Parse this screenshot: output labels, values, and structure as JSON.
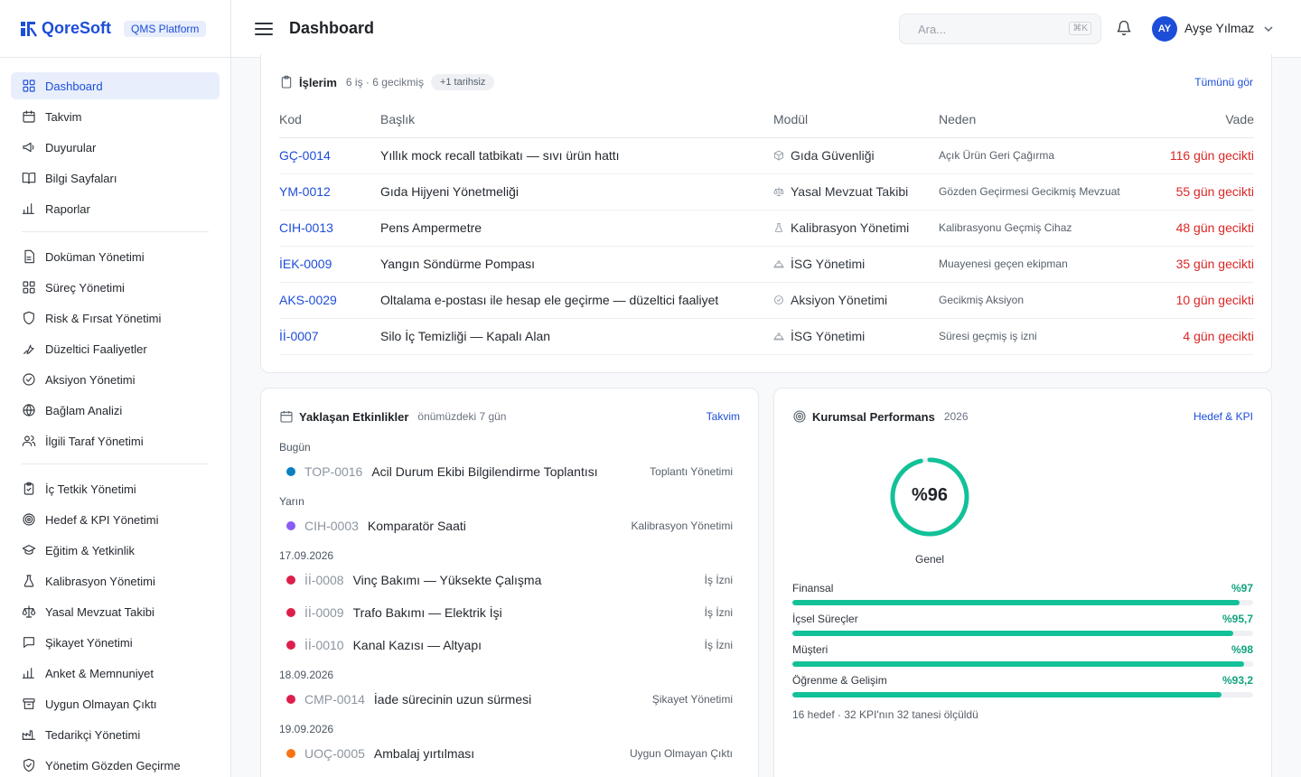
{
  "brand": {
    "name": "QoreSoft",
    "badge": "QMS Platform"
  },
  "header": {
    "title": "Dashboard",
    "search_placeholder": "Ara...",
    "search_shortcut": "⌘K",
    "user_initials": "AY",
    "user_name": "Ayşe Yılmaz"
  },
  "sidebar": {
    "groups": [
      [
        {
          "label": "Dashboard",
          "icon": "grid-icon",
          "active": true
        },
        {
          "label": "Takvim",
          "icon": "calendar-icon"
        },
        {
          "label": "Duyurular",
          "icon": "megaphone-icon"
        },
        {
          "label": "Bilgi Sayfaları",
          "icon": "book-icon"
        },
        {
          "label": "Raporlar",
          "icon": "bar-chart-icon"
        }
      ],
      [
        {
          "label": "Doküman Yönetimi",
          "icon": "document-icon"
        },
        {
          "label": "Süreç Yönetimi",
          "icon": "grid-icon"
        },
        {
          "label": "Risk & Fırsat Yönetimi",
          "icon": "shield-icon"
        },
        {
          "label": "Düzeltici Faaliyetler",
          "icon": "wrench-icon"
        },
        {
          "label": "Aksiyon Yönetimi",
          "icon": "check-circle-icon"
        },
        {
          "label": "Bağlam Analizi",
          "icon": "globe-icon"
        },
        {
          "label": "İlgili Taraf Yönetimi",
          "icon": "users-icon"
        }
      ],
      [
        {
          "label": "İç Tetkik Yönetimi",
          "icon": "clipboard-check-icon"
        },
        {
          "label": "Hedef & KPI Yönetimi",
          "icon": "target-icon"
        },
        {
          "label": "Eğitim & Yetkinlik",
          "icon": "graduation-cap-icon"
        },
        {
          "label": "Kalibrasyon Yönetimi",
          "icon": "flask-icon"
        },
        {
          "label": "Yasal Mevzuat Takibi",
          "icon": "scale-icon"
        },
        {
          "label": "Şikayet Yönetimi",
          "icon": "message-icon"
        },
        {
          "label": "Anket & Memnuniyet",
          "icon": "bar-chart-icon"
        },
        {
          "label": "Uygun Olmayan Çıktı",
          "icon": "archive-icon"
        },
        {
          "label": "Tedarikçi Yönetimi",
          "icon": "factory-icon"
        },
        {
          "label": "Yönetim Gözden Geçirme",
          "icon": "shield-check-icon"
        }
      ]
    ]
  },
  "tasks": {
    "title": "İşlerim",
    "subtitle": "6 iş · 6 gecikmiş",
    "pill": "+1 tarihsiz",
    "link": "Tümünü gör",
    "columns": {
      "code": "Kod",
      "title": "Başlık",
      "module": "Modül",
      "reason": "Neden",
      "due": "Vade"
    },
    "rows": [
      {
        "code": "GÇ-0014",
        "title": "Yıllık mock recall tatbikatı — sıvı ürün hattı",
        "module": "Gıda Güvenliği",
        "module_icon": "cube-icon",
        "reason": "Açık Ürün Geri Çağırma",
        "due": "116 gün gecikti"
      },
      {
        "code": "YM-0012",
        "title": "Gıda Hijyeni Yönetmeliği",
        "module": "Yasal Mevzuat Takibi",
        "module_icon": "scale-icon",
        "reason": "Gözden Geçirmesi Gecikmiş Mevzuat",
        "due": "55 gün gecikti"
      },
      {
        "code": "CIH-0013",
        "title": "Pens Ampermetre",
        "module": "Kalibrasyon Yönetimi",
        "module_icon": "flask-icon",
        "reason": "Kalibrasyonu Geçmiş Cihaz",
        "due": "48 gün gecikti"
      },
      {
        "code": "İEK-0009",
        "title": "Yangın Söndürme Pompası",
        "module": "İSG Yönetimi",
        "module_icon": "hard-hat-icon",
        "reason": "Muayenesi geçen ekipman",
        "due": "35 gün gecikti"
      },
      {
        "code": "AKS-0029",
        "title": "Oltalama e-postası ile hesap ele geçirme — düzeltici faaliyet",
        "module": "Aksiyon Yönetimi",
        "module_icon": "check-circle-icon",
        "reason": "Gecikmiş Aksiyon",
        "due": "10 gün gecikti"
      },
      {
        "code": "İİ-0007",
        "title": "Silo İç Temizliği — Kapalı Alan",
        "module": "İSG Yönetimi",
        "module_icon": "hard-hat-icon",
        "reason": "Süresi geçmiş iş izni",
        "due": "4 gün gecikti"
      }
    ]
  },
  "events": {
    "title": "Yaklaşan Etkinlikler",
    "subtitle": "önümüzdeki 7 gün",
    "link": "Takvim",
    "groups": [
      {
        "label": "Bugün",
        "items": [
          {
            "code": "TOP-0016",
            "title": "Acil Durum Ekibi Bilgilendirme Toplantısı",
            "module": "Toplantı Yönetimi",
            "color": "#0b7fc1"
          }
        ]
      },
      {
        "label": "Yarın",
        "items": [
          {
            "code": "CIH-0003",
            "title": "Komparatör Saati",
            "module": "Kalibrasyon Yönetimi",
            "color": "#8b5cf6"
          }
        ]
      },
      {
        "label": "17.09.2026",
        "items": [
          {
            "code": "İİ-0008",
            "title": "Vinç Bakımı — Yüksekte Çalışma",
            "module": "İş İzni",
            "color": "#dc1f4b"
          },
          {
            "code": "İİ-0009",
            "title": "Trafo Bakımı — Elektrik İşi",
            "module": "İş İzni",
            "color": "#dc1f4b"
          },
          {
            "code": "İİ-0010",
            "title": "Kanal Kazısı — Altyapı",
            "module": "İş İzni",
            "color": "#dc1f4b"
          }
        ]
      },
      {
        "label": "18.09.2026",
        "items": [
          {
            "code": "CMP-0014",
            "title": "İade sürecinin uzun sürmesi",
            "module": "Şikayet Yönetimi",
            "color": "#dc1f4b"
          }
        ]
      },
      {
        "label": "19.09.2026",
        "items": [
          {
            "code": "UOÇ-0005",
            "title": "Ambalaj yırtılması",
            "module": "Uygun Olmayan Çıktı",
            "color": "#f97316"
          }
        ]
      }
    ]
  },
  "performance": {
    "title": "Kurumsal Performans",
    "year": "2026",
    "link": "Hedef & KPI",
    "overall_label": "%96",
    "overall_value": 96,
    "overall_caption": "Genel",
    "kpis": [
      {
        "name": "Finansal",
        "label": "%97",
        "value": 97
      },
      {
        "name": "İçsel Süreçler",
        "label": "%95,7",
        "value": 95.7
      },
      {
        "name": "Müşteri",
        "label": "%98",
        "value": 98
      },
      {
        "name": "Öğrenme & Gelişim",
        "label": "%93,2",
        "value": 93.2
      }
    ],
    "footer": "16 hedef · 32 KPI'nın 32 tanesi ölçüldü"
  }
}
